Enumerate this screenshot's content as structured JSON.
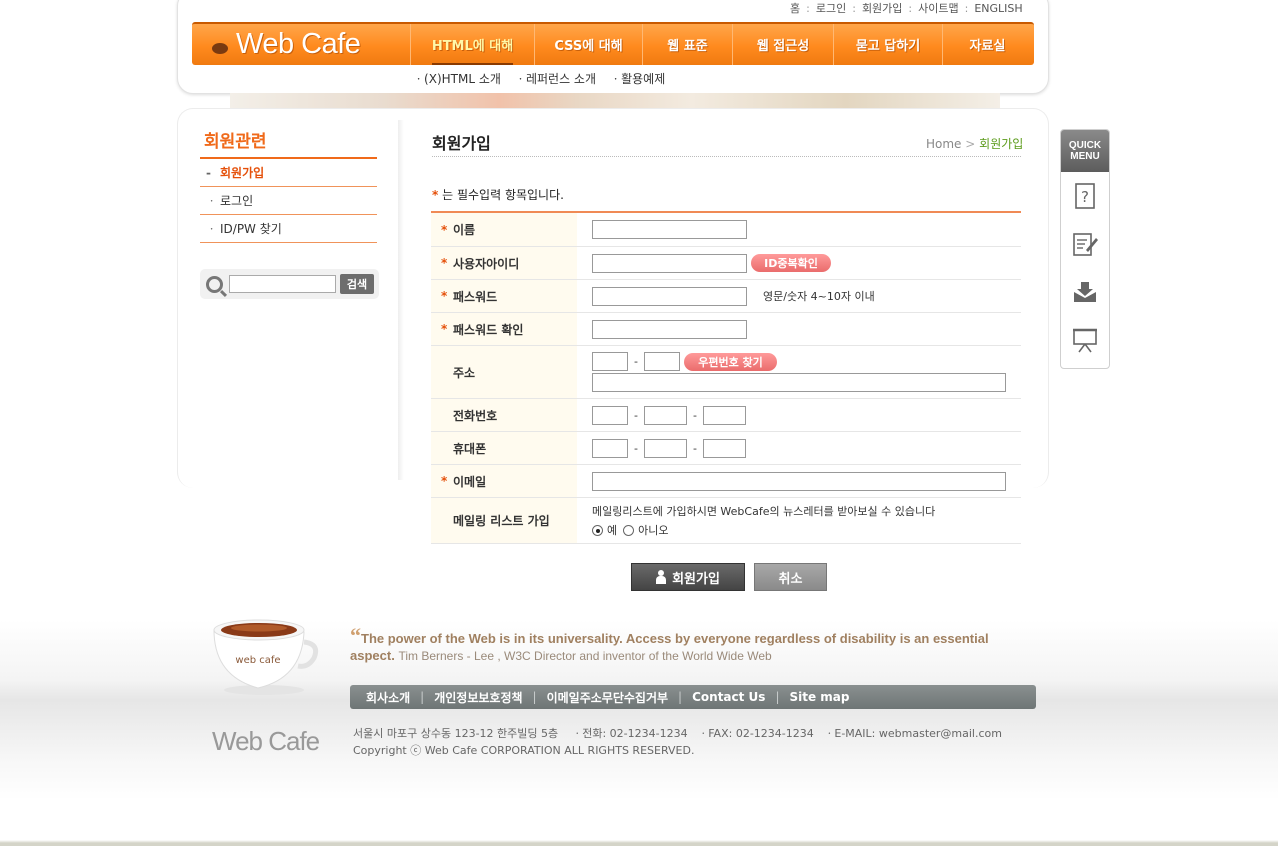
{
  "top_links": [
    "홈",
    "로그인",
    "회원가입",
    "사이트맵",
    "ENGLISH"
  ],
  "logo_text": "Web Cafe",
  "nav": [
    "HTML에 대해",
    "CSS에 대해",
    "웹 표준",
    "웹 접근성",
    "묻고 답하기",
    "자료실"
  ],
  "subnav": [
    "ㆍ(X)HTML 소개",
    "ㆍ레퍼런스 소개",
    "ㆍ활용예제"
  ],
  "sidebar": {
    "title": "회원관련",
    "items": [
      {
        "bullet": "-",
        "label": "회원가입"
      },
      {
        "bullet": "ㆍ",
        "label": "로그인"
      },
      {
        "bullet": "ㆍ",
        "label": "ID/PW 찾기"
      }
    ],
    "search_button": "검색"
  },
  "main": {
    "title": "회원가입",
    "breadcrumb_home": "Home",
    "breadcrumb_sep": ">",
    "breadcrumb_current": "회원가입",
    "required_star": "*",
    "required_note": "는 필수입력 항목입니다.",
    "fields": {
      "name": "이름",
      "userid": "사용자아이디",
      "userid_check": "ID중복확인",
      "password": "패스워드",
      "password_hint": "영문/숫자 4~10자 이내",
      "password_confirm": "패스워드 확인",
      "address": "주소",
      "zip_search": "우편번호 찾기",
      "phone": "전화번호",
      "mobile": "휴대폰",
      "email": "이메일",
      "mailing": "메일링 리스트 가입",
      "mailing_desc": "메일링리스트에 가입하시면 WebCafe의 뉴스레터를 받아보실 수 있습니다",
      "yes": "예",
      "no": "아니오"
    },
    "join_button": "회원가입",
    "cancel_button": "취소"
  },
  "quick_menu": {
    "title_line1": "QUICK",
    "title_line2": "MENU",
    "icons": [
      "help-icon",
      "edit-document-icon",
      "download-icon",
      "presentation-icon"
    ]
  },
  "footer": {
    "cup_text": "web cafe",
    "quote": "The power of the Web is in its universality. Access by everyone regardless of disability is an essential aspect.",
    "quote_attrib": "Tim Berners - Lee , W3C Director and inventor of the World Wide Web",
    "nav": [
      "회사소개",
      "개인정보보호정책",
      "이메일주소무단수집거부",
      "Contact Us",
      "Site map"
    ],
    "logo": "Web Cafe",
    "address": "서울시 마포구 상수동 123-12 한주빌딩 5층",
    "phone": "ㆍ전화: 02-1234-1234",
    "fax": "ㆍFAX: 02-1234-1234",
    "email": "ㆍE-MAIL: webmaster@mail.com",
    "copyright": "Copyright ⓒ Web Cafe CORPORATION ALL RIGHTS RESERVED."
  },
  "colors": {
    "accent_orange": "#ff8a1e",
    "required_red": "#e5500a",
    "breadcrumb_green": "#5b9b1a"
  }
}
